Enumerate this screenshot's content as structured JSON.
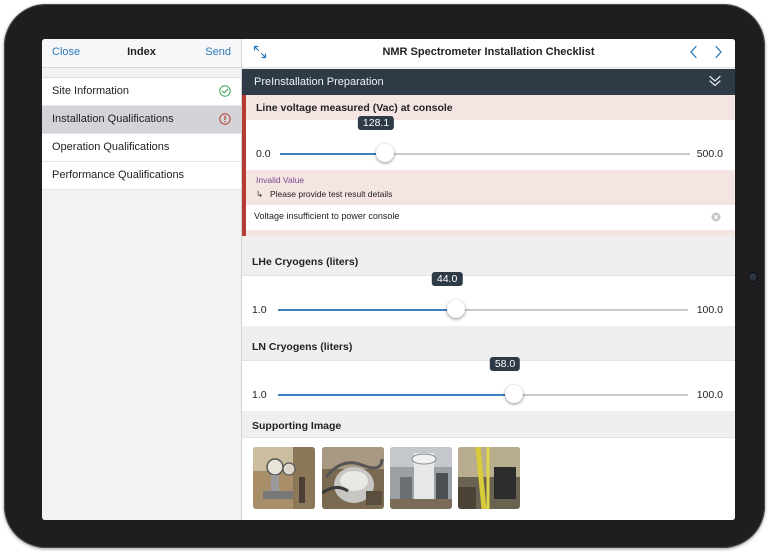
{
  "sidebar": {
    "close_label": "Close",
    "title": "Index",
    "send_label": "Send",
    "items": [
      {
        "label": "Site Information",
        "status": "complete"
      },
      {
        "label": "Installation Qualifications",
        "status": "error"
      },
      {
        "label": "Operation Qualifications",
        "status": "none"
      },
      {
        "label": "Performance Qualifications",
        "status": "none"
      }
    ]
  },
  "header": {
    "title": "NMR Spectrometer Installation Checklist"
  },
  "section": {
    "title": "PreInstallation Preparation"
  },
  "questions": [
    {
      "label": "Line voltage measured (Vac) at console",
      "min_label": "0.0",
      "max_label": "500.0",
      "min": 0,
      "max": 500,
      "value": 128.1,
      "value_label": "128.1",
      "invalid": true,
      "error_title": "Invalid Value",
      "error_prompt": "Please provide test result details",
      "detail_value": "Voltage insufficient to power console"
    },
    {
      "label": "LHe Cryogens (liters)",
      "min_label": "1.0",
      "max_label": "100.0",
      "min": 1,
      "max": 100,
      "value": 44.0,
      "value_label": "44.0"
    },
    {
      "label": "LN Cryogens (liters)",
      "min_label": "1.0",
      "max_label": "100.0",
      "min": 1,
      "max": 100,
      "value": 58.0,
      "value_label": "58.0"
    }
  ],
  "images": {
    "label": "Supporting Image",
    "count": 4
  },
  "colors": {
    "accent": "#2a78b8",
    "slider_fill": "#3e7fbf",
    "section_bar": "#2f3a47",
    "error": "#b53b33",
    "error_bg": "#f4e5e2",
    "success": "#3aa55a"
  }
}
